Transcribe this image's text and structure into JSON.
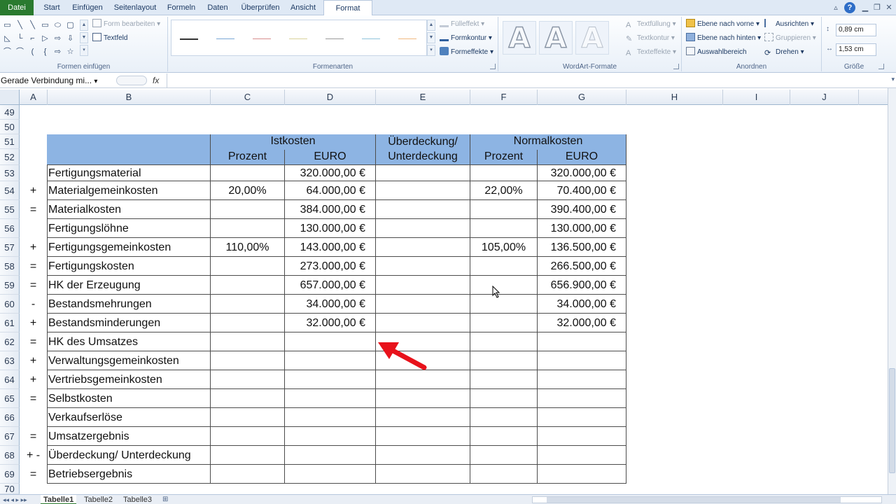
{
  "tabs": [
    {
      "label": "Datei",
      "kind": "file"
    },
    {
      "label": "Start"
    },
    {
      "label": "Einfügen"
    },
    {
      "label": "Seitenlayout"
    },
    {
      "label": "Formeln"
    },
    {
      "label": "Daten"
    },
    {
      "label": "Überprüfen"
    },
    {
      "label": "Ansicht"
    },
    {
      "label": "Format",
      "kind": "active"
    }
  ],
  "ribbon": {
    "formen_einfuegen": {
      "label": "Formen einfügen",
      "form_bearbeiten": "Form bearbeiten",
      "textfeld": "Textfeld"
    },
    "formenarten": {
      "label": "Formenarten",
      "fuelleffekt": "Fülleffekt",
      "formkontur": "Formkontur",
      "formeffekte": "Formeffekte"
    },
    "wordart": {
      "label": "WordArt-Formate",
      "textfuellung": "Textfüllung",
      "textkontur": "Textkontur",
      "texteffekte": "Texteffekte",
      "sample": "A"
    },
    "anordnen": {
      "label": "Anordnen",
      "ebene_vorne": "Ebene nach vorne",
      "ebene_hinten": "Ebene nach hinten",
      "auswahlbereich": "Auswahlbereich",
      "ausrichten": "Ausrichten",
      "gruppieren": "Gruppieren",
      "drehen": "Drehen"
    },
    "groesse": {
      "label": "Größe",
      "height": "0,89 cm",
      "width": "1,53 cm"
    }
  },
  "formula_bar": {
    "name_box": "Gerade Verbindung mi...",
    "fx": "fx",
    "value": ""
  },
  "columns": [
    "A",
    "B",
    "C",
    "D",
    "E",
    "F",
    "G",
    "H",
    "I",
    "J"
  ],
  "rows": [
    "49",
    "50",
    "51",
    "52",
    "53",
    "54",
    "55",
    "56",
    "57",
    "58",
    "59",
    "60",
    "61",
    "62",
    "63",
    "64",
    "65",
    "66",
    "67",
    "68",
    "69",
    "70"
  ],
  "table": {
    "istkosten": "Istkosten",
    "normalkosten": "Normalkosten",
    "ueberdeckung_line1": "Überdeckung/",
    "ueberdeckung_line2": "Unterdeckung",
    "prozent": "Prozent",
    "euro": "EURO",
    "body": [
      {
        "op": "",
        "label": "Fertigungsmaterial",
        "ist_pct": "",
        "ist_eur": "320.000,00 €",
        "norm_pct": "",
        "norm_eur": "320.000,00 €"
      },
      {
        "op": "+",
        "label": "Materialgemeinkosten",
        "ist_pct": "20,00%",
        "ist_eur": "64.000,00 €",
        "norm_pct": "22,00%",
        "norm_eur": "70.400,00 €"
      },
      {
        "op": "=",
        "label": "Materialkosten",
        "ist_pct": "",
        "ist_eur": "384.000,00 €",
        "norm_pct": "",
        "norm_eur": "390.400,00 €"
      },
      {
        "op": "",
        "label": "Fertigungslöhne",
        "ist_pct": "",
        "ist_eur": "130.000,00 €",
        "norm_pct": "",
        "norm_eur": "130.000,00 €"
      },
      {
        "op": "+",
        "label": "Fertigungsgemeinkosten",
        "ist_pct": "110,00%",
        "ist_eur": "143.000,00 €",
        "norm_pct": "105,00%",
        "norm_eur": "136.500,00 €"
      },
      {
        "op": "=",
        "label": "Fertigungskosten",
        "ist_pct": "",
        "ist_eur": "273.000,00 €",
        "norm_pct": "",
        "norm_eur": "266.500,00 €"
      },
      {
        "op": "=",
        "label": "HK der Erzeugung",
        "ist_pct": "",
        "ist_eur": "657.000,00 €",
        "norm_pct": "",
        "norm_eur": "656.900,00 €"
      },
      {
        "op": "-",
        "label": "Bestandsmehrungen",
        "ist_pct": "",
        "ist_eur": "34.000,00 €",
        "norm_pct": "",
        "norm_eur": "34.000,00 €"
      },
      {
        "op": "+",
        "label": "Bestandsminderungen",
        "ist_pct": "",
        "ist_eur": "32.000,00 €",
        "norm_pct": "",
        "norm_eur": "32.000,00 €"
      },
      {
        "op": "=",
        "label": "HK des Umsatzes",
        "ist_pct": "",
        "ist_eur": "",
        "norm_pct": "",
        "norm_eur": ""
      },
      {
        "op": "+",
        "label": "Verwaltungsgemeinkosten",
        "ist_pct": "",
        "ist_eur": "",
        "norm_pct": "",
        "norm_eur": ""
      },
      {
        "op": "+",
        "label": "Vertriebsgemeinkosten",
        "ist_pct": "",
        "ist_eur": "",
        "norm_pct": "",
        "norm_eur": ""
      },
      {
        "op": "=",
        "label": "Selbstkosten",
        "ist_pct": "",
        "ist_eur": "",
        "norm_pct": "",
        "norm_eur": ""
      },
      {
        "op": "",
        "label": "Verkaufserlöse",
        "ist_pct": "",
        "ist_eur": "",
        "norm_pct": "",
        "norm_eur": ""
      },
      {
        "op": "=",
        "label": "Umsatzergebnis",
        "ist_pct": "",
        "ist_eur": "",
        "norm_pct": "",
        "norm_eur": ""
      },
      {
        "op": "+ -",
        "label": "Überdeckung/ Unterdeckung",
        "ist_pct": "",
        "ist_eur": "",
        "norm_pct": "",
        "norm_eur": ""
      },
      {
        "op": "=",
        "label": "Betriebsergebnis",
        "ist_pct": "",
        "ist_eur": "",
        "norm_pct": "",
        "norm_eur": ""
      }
    ]
  },
  "sheets": [
    "Tabelle1",
    "Tabelle2",
    "Tabelle3"
  ],
  "colors": {
    "header_fill": "#8db4e3",
    "arrow": "#e8121b",
    "file_tab": "#2a7a2f"
  }
}
